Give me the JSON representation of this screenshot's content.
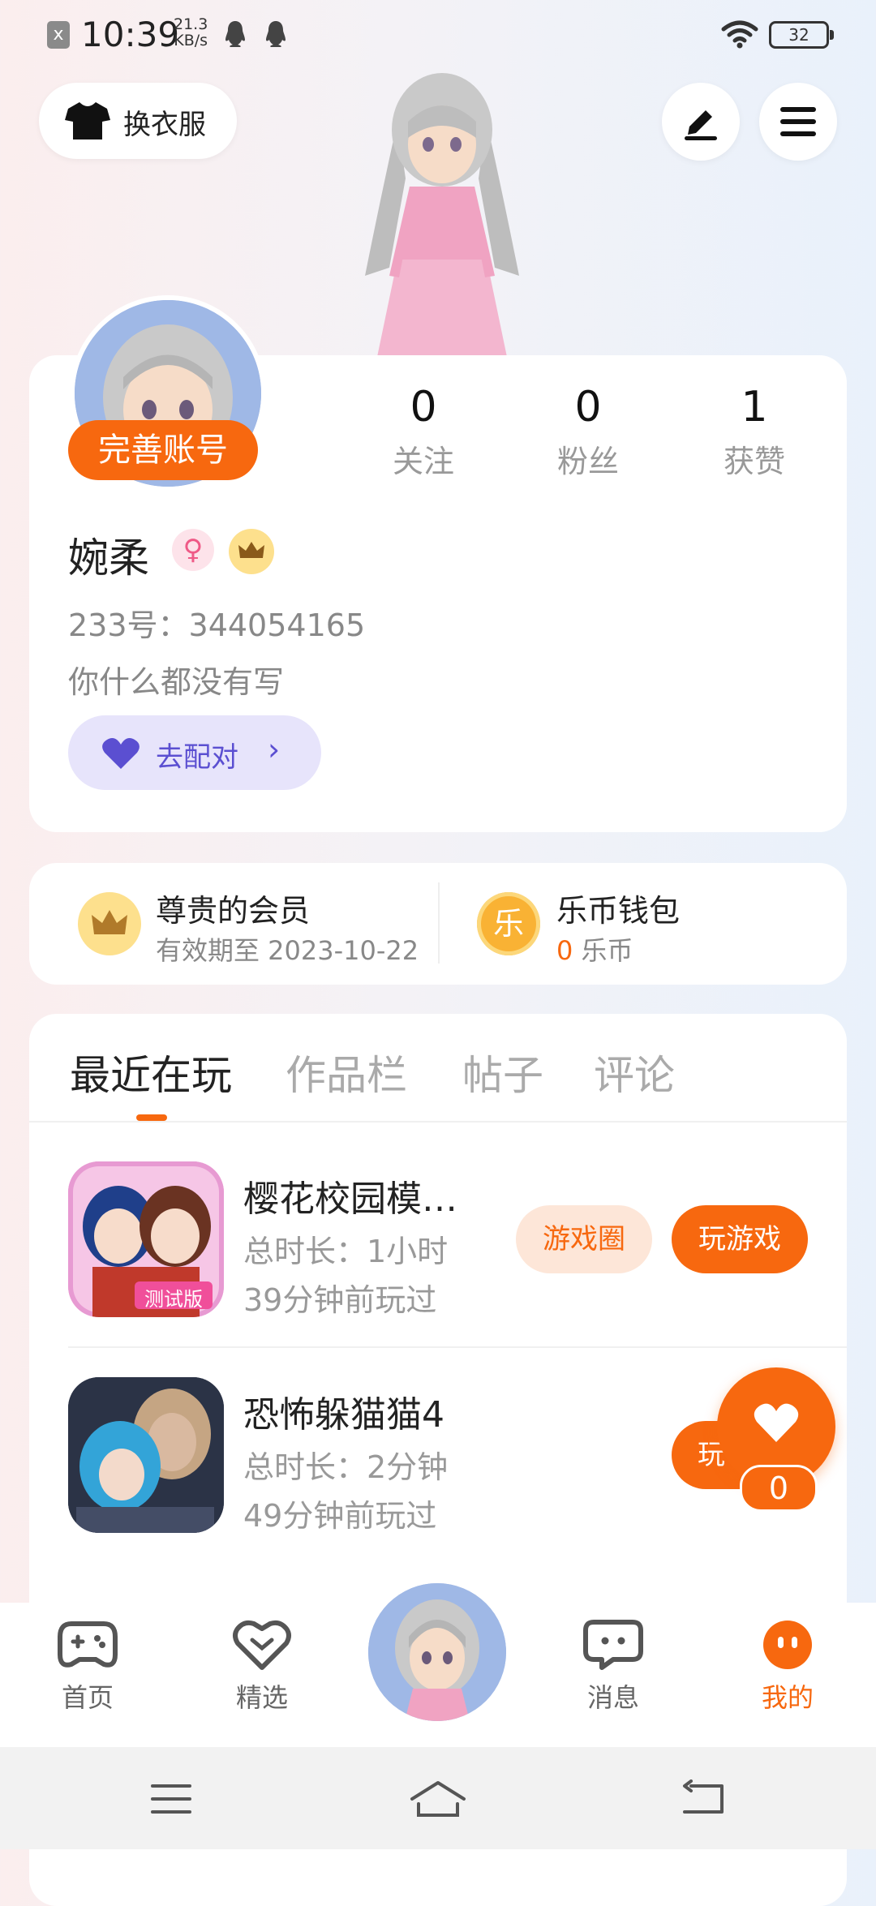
{
  "status_bar": {
    "close": "x",
    "time": "10:39",
    "speed_value": "21.3",
    "speed_unit": "KB/s",
    "battery": "32"
  },
  "top": {
    "dress_label": "换衣服"
  },
  "profile": {
    "complete_label": "完善账号",
    "stats": [
      {
        "value": "0",
        "label": "关注"
      },
      {
        "value": "0",
        "label": "粉丝"
      },
      {
        "value": "1",
        "label": "获赞"
      }
    ],
    "username": "婉柔",
    "gender_symbol": "♀",
    "uid": "233号：344054165",
    "bio": "你什么都没有写",
    "match_label": "去配对",
    "match_chevron": "›"
  },
  "membership": {
    "vip_title": "尊贵的会员",
    "vip_sub": "有效期至 2023-10-22",
    "wallet_icon_text": "乐",
    "wallet_title": "乐币钱包",
    "wallet_amount": "0",
    "wallet_unit": "乐币"
  },
  "tabs": [
    "最近在玩",
    "作品栏",
    "帖子",
    "评论"
  ],
  "games": [
    {
      "name": "樱花校园模…",
      "duration": "总时长：1小时",
      "last_played": "39分钟前玩过",
      "circle_label": "游戏圈",
      "play_label": "玩游戏",
      "tag": "测试版"
    },
    {
      "name": "恐怖躲猫猫4",
      "duration": "总时长：2分钟",
      "last_played": "49分钟前玩过",
      "play_label": "玩"
    }
  ],
  "like": {
    "count": "0"
  },
  "nav": [
    "首页",
    "精选",
    "消息",
    "我的"
  ],
  "colors": {
    "accent": "#f7680f",
    "match": "#5b4fd1",
    "pfp_bg": "#9fb8e6"
  },
  "icons": [
    "tshirt-icon",
    "edit-pen-icon",
    "menu-icon",
    "heart-icon",
    "crown-icon",
    "gamepad-icon",
    "heart-badge-icon",
    "chat-icon",
    "face-icon"
  ]
}
